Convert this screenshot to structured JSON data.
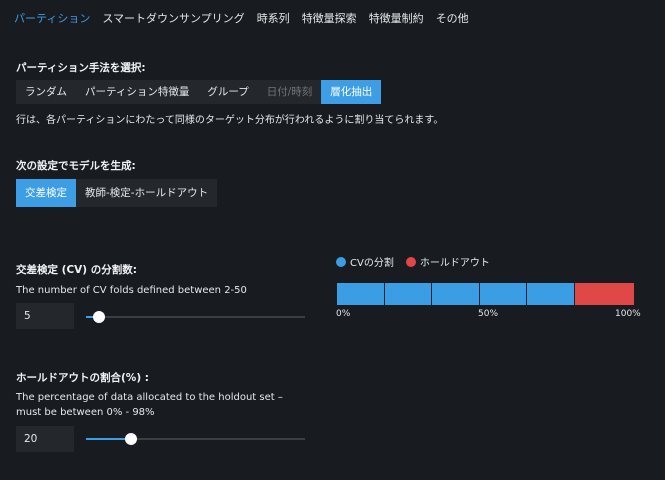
{
  "tabs": [
    {
      "label": "パーティション",
      "active": true
    },
    {
      "label": "スマートダウンサンプリング",
      "active": false
    },
    {
      "label": "時系列",
      "active": false
    },
    {
      "label": "特徴量探索",
      "active": false
    },
    {
      "label": "特徴量制約",
      "active": false
    },
    {
      "label": "その他",
      "active": false
    }
  ],
  "partition": {
    "title": "パーティション手法を選択:",
    "methods": [
      {
        "label": "ランダム",
        "state": "normal"
      },
      {
        "label": "パーティション特徴量",
        "state": "normal"
      },
      {
        "label": "グループ",
        "state": "normal"
      },
      {
        "label": "日付/時刻",
        "state": "disabled"
      },
      {
        "label": "層化抽出",
        "state": "active"
      }
    ],
    "description": "行は、各パーティションにわたって同様のターゲット分布が行われるように割り当てられます。"
  },
  "model": {
    "title": "次の設定でモデルを生成:",
    "options": [
      {
        "label": "交差検定",
        "state": "active"
      },
      {
        "label": "教師-検定-ホールドアウト",
        "state": "normal"
      }
    ]
  },
  "cv": {
    "title": "交差検定 (CV) の分割数:",
    "description": "The number of CV folds defined between 2-50",
    "value": "5",
    "slider_fraction": 0.06
  },
  "holdout": {
    "title": "ホールドアウトの割合(%) :",
    "description": "The percentage of data allocated to the holdout set – must be between 0% - 98%",
    "value": "20",
    "slider_fraction": 0.204
  },
  "chart_data": {
    "type": "bar",
    "legend": [
      "CVの分割",
      "ホールドアウト"
    ],
    "colors": {
      "cv": "#3b9de4",
      "holdout": "#e04848"
    },
    "cv_folds": 5,
    "cv_percent": 80,
    "holdout_percent": 20,
    "ticks": [
      "0%",
      "50%",
      "100%"
    ]
  }
}
